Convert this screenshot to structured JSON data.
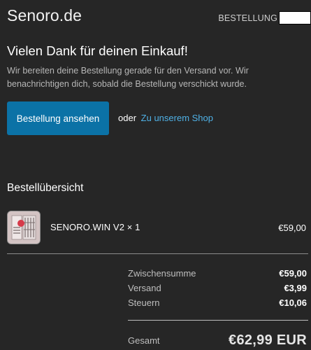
{
  "header": {
    "logo": "Senoro.de",
    "order_label": "BESTELLUNG"
  },
  "confirmation": {
    "title": "Vielen Dank für deinen Einkauf!",
    "message": "Wir bereiten deine Bestellung gerade für den Versand vor. Wir benachrichtigen dich, sobald die Bestellung verschickt wurde."
  },
  "actions": {
    "view_order_label": "Bestellung ansehen",
    "or_text": "oder",
    "shop_link_label": "Zu unserem Shop"
  },
  "overview": {
    "title": "Bestellübersicht",
    "items": [
      {
        "name": "SENORO.WIN V2 × 1",
        "price": "€59,00"
      }
    ]
  },
  "summary": {
    "rows": [
      {
        "label": "Zwischensumme",
        "value": "€59,00"
      },
      {
        "label": "Versand",
        "value": "€3,99"
      },
      {
        "label": "Steuern",
        "value": "€10,06"
      }
    ],
    "total_label": "Gesamt",
    "total_value": "€62,99 EUR"
  },
  "colors": {
    "background": "#262626",
    "button": "#0b72a6",
    "link": "#4fb1e6"
  }
}
